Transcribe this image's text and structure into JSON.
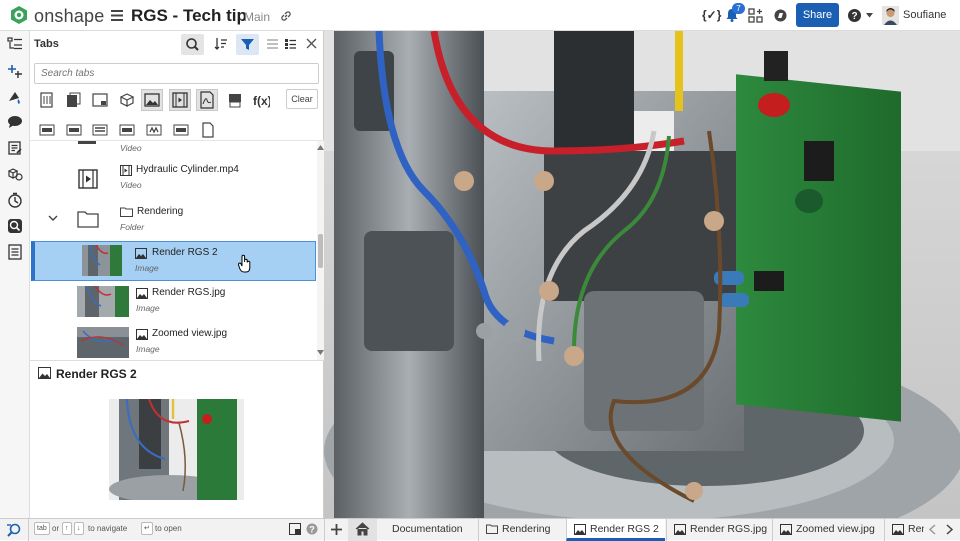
{
  "app": {
    "brand": "onshape",
    "doc_title": "RGS - Tech tip",
    "branch": "Main",
    "share_label": "Share",
    "user": "Soufiane",
    "notification_count": "7",
    "accent": "#1a5fb4",
    "brand_green": "#3aa35a"
  },
  "panel": {
    "title": "Tabs",
    "search_placeholder": "Search tabs",
    "clear_label": "Clear",
    "items": [
      {
        "name": "",
        "type": "Video"
      },
      {
        "name": "Hydraulic Cylinder.mp4",
        "type": "Video"
      },
      {
        "name": "Rendering",
        "type": "Folder"
      },
      {
        "name": "Render RGS 2",
        "type": "Image"
      },
      {
        "name": "Render RGS.jpg",
        "type": "Image"
      },
      {
        "name": "Zoomed view.jpg",
        "type": "Image"
      }
    ],
    "preview_title": "Render RGS 2"
  },
  "hints": {
    "tab_key": "tab",
    "or": "or",
    "up_key": "↑",
    "down_key": "↓",
    "navigate": "to navigate",
    "enter_key": "↵",
    "open": "to open"
  },
  "bottom_tabs": [
    {
      "label": "Documentation"
    },
    {
      "label": "Rendering"
    },
    {
      "label": "Render RGS 2"
    },
    {
      "label": "Render RGS.jpg"
    },
    {
      "label": "Zoomed view.jpg"
    },
    {
      "label": "Ren"
    }
  ],
  "toolbar_icons": [
    "curly-braces-icon",
    "bell-icon",
    "app-store-icon",
    "learning-center-icon",
    "help-icon"
  ],
  "left_icons": [
    "feature-list-icon",
    "insert-icon",
    "appearance-icon",
    "comments-icon",
    "notes-icon",
    "parts-icon",
    "history-icon",
    "search-tabs-icon",
    "list-icon"
  ]
}
